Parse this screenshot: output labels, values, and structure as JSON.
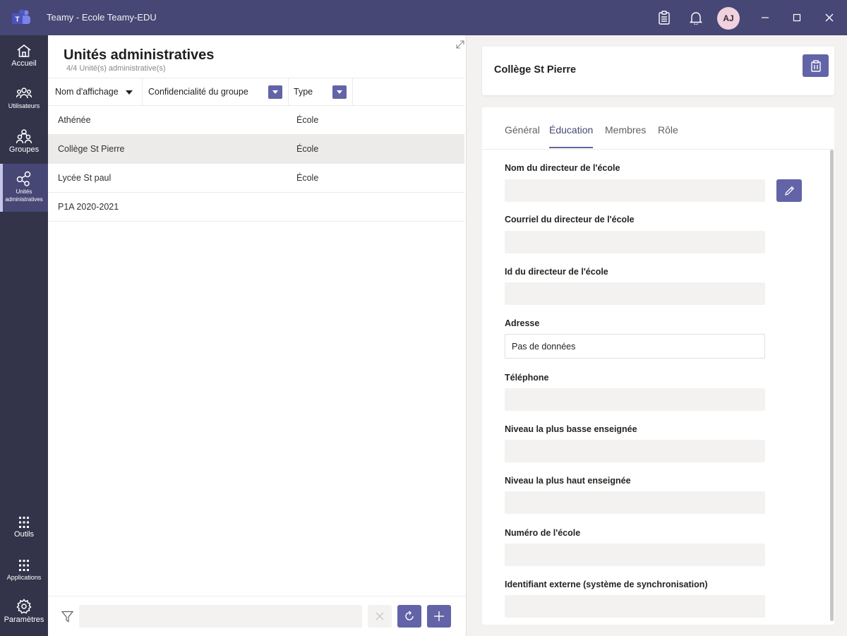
{
  "app": {
    "title": "Teamy - Ecole Teamy-EDU",
    "avatar_initials": "AJ",
    "accent": "#6264a7",
    "titlebar_color": "#464775",
    "rail_color": "#33344a"
  },
  "rail": {
    "items": [
      {
        "label": "Accueil",
        "icon": "home-icon"
      },
      {
        "label": "Utilisateurs",
        "icon": "users-icon"
      },
      {
        "label": "Groupes",
        "icon": "groups-icon"
      },
      {
        "label": "Unités administratives",
        "icon": "admin-units-icon"
      },
      {
        "label": "Outils",
        "icon": "grid-icon"
      },
      {
        "label": "Applications",
        "icon": "apps-grid-icon"
      },
      {
        "label": "Paramètres",
        "icon": "gear-icon"
      }
    ]
  },
  "list": {
    "title": "Unités administratives",
    "subtitle": "4/4 Unité(s) administrative(s)",
    "columns": [
      "Nom d'affichage",
      "Confidencialité du groupe",
      "Type"
    ],
    "rows": [
      {
        "name": "Athénée",
        "privacy": "",
        "type": "École"
      },
      {
        "name": "Collège St Pierre",
        "privacy": "",
        "type": "École"
      },
      {
        "name": "Lycée St paul",
        "privacy": "",
        "type": "École"
      },
      {
        "name": "P1A 2020-2021",
        "privacy": "",
        "type": ""
      }
    ],
    "selected_row": 1
  },
  "detail": {
    "title": "Collège St Pierre",
    "tabs": [
      "Général",
      "Éducation",
      "Membres",
      "Rôle"
    ],
    "active_tab": "Éducation",
    "fields": [
      {
        "label": "Nom du directeur de l'école",
        "value": ""
      },
      {
        "label": "Courriel du directeur de l'école",
        "value": ""
      },
      {
        "label": "Id du directeur de l'école",
        "value": ""
      },
      {
        "label": "Adresse",
        "value": "Pas de données"
      },
      {
        "label": "Téléphone",
        "value": ""
      },
      {
        "label": "Niveau la plus basse enseignée",
        "value": ""
      },
      {
        "label": "Niveau la plus haut enseignée",
        "value": ""
      },
      {
        "label": "Numéro de l'école",
        "value": ""
      },
      {
        "label": "Identifiant externe (système de synchronisation)",
        "value": ""
      }
    ]
  }
}
